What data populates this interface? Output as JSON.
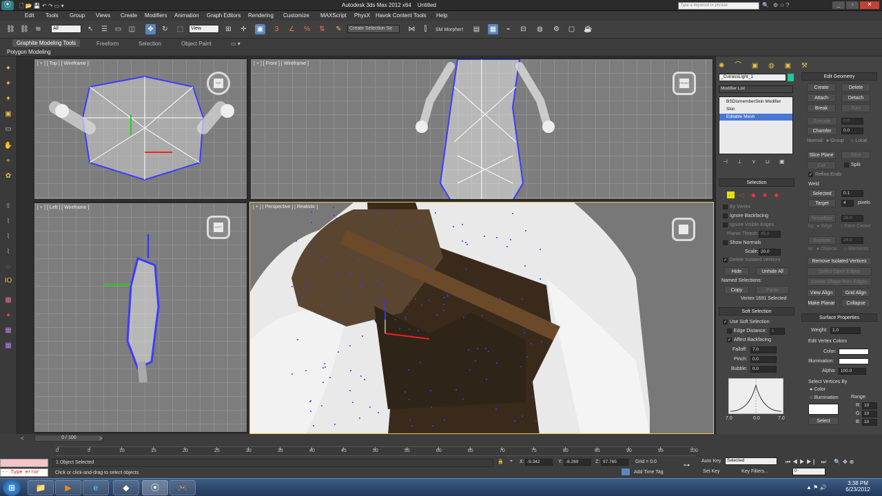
{
  "window": {
    "title": "Autodesk 3ds Max 2012 x64",
    "doc": "Untitled",
    "search_placeholder": "Type a keyword or phrase"
  },
  "menu": [
    "Edit",
    "Tools",
    "Group",
    "Views",
    "Create",
    "Modifiers",
    "Animation",
    "Graph Editors",
    "Rendering",
    "Customize",
    "MAXScript",
    "PhysX",
    "Havok Content Tools",
    "Help"
  ],
  "toolbar": {
    "filter": "All",
    "refcoord": "View",
    "named_selection": "Create Selection Se",
    "morpher": "SM Morpher!"
  },
  "ribbon": {
    "tabs": [
      "Graphite Modeling Tools",
      "Freeform",
      "Selection",
      "Object Paint"
    ],
    "sub": "Polygon Modeling"
  },
  "viewports": {
    "top": "[ + ] [ Top ] [ Wireframe ]",
    "front": "[ + ] [ Front ] [ Wireframe ]",
    "left": "[ + ] [ Left ] [ Wireframe ]",
    "persp": "[ + ] [ Perspective ] [ Realistic ]",
    "cube_top": "TOP",
    "cube_front": "FRONT",
    "cube_left": "LEFT"
  },
  "cmd": {
    "object_name": "_CuirassLight_1",
    "modifier_list": "Modifier List",
    "stack": [
      "BSDismemberSkin Modifier",
      "Skin",
      "Editable Mesh"
    ],
    "selection": {
      "title": "Selection",
      "by_vertex": "By Vertex",
      "ignore_backfacing": "Ignore Backfacing",
      "ignore_visible_edges": "Ignore Visible Edges",
      "planar_thresh": "Planar Thresh:",
      "planar_val": "45.0",
      "show_normals": "Show Normals",
      "scale": "Scale:",
      "scale_val": "20.0",
      "delete_isolated": "Delete Isolated Vertices",
      "hide": "Hide",
      "unhide_all": "Unhide All",
      "named_selections": "Named Selections:",
      "copy": "Copy",
      "paste": "Paste",
      "status": "Vertex 1691 Selected"
    },
    "soft": {
      "title": "Soft Selection",
      "use_soft": "Use Soft Selection",
      "edge_distance": "Edge Distance:",
      "edge_val": "1",
      "affect_backfacing": "Affect Backfacing",
      "falloff": "Falloff:",
      "falloff_val": "7.0",
      "pinch": "Pinch:",
      "pinch_val": "0.0",
      "bubble": "Bubble:",
      "bubble_val": "0.0",
      "curve_labels": [
        "7.0",
        "0.0",
        "7.0"
      ]
    },
    "edit_geom": {
      "title": "Edit Geometry",
      "create": "Create",
      "delete": "Delete",
      "attach": "Attach",
      "detach": "Detach",
      "break": "Break",
      "turn": "Turn",
      "extrude": "Extrude",
      "extrude_val": "0.0",
      "chamfer": "Chamfer",
      "chamfer_val": "0.0",
      "normal": "Normal:",
      "group": "Group",
      "local": "Local",
      "slice_plane": "Slice Plane",
      "slice": "Slice",
      "cut": "Cut",
      "split": "Split",
      "refine_ends": "Refine Ends",
      "weld": "Weld",
      "selected": "Selected",
      "selected_val": "0.1",
      "target": "Target",
      "target_val": "4",
      "pixels": "pixels",
      "tessellate": "Tessellate",
      "tess_val": "25.0",
      "by": "by:",
      "edge": "Edge",
      "face_center": "Face-Center",
      "explode": "Explode",
      "explode_val": "24.0",
      "to": "to:",
      "objects": "Objects",
      "elements": "Elements",
      "remove_isolated": "Remove Isolated Vertices",
      "select_open_edges": "Select Open Edges",
      "create_shape": "Create Shape from Edges",
      "view_align": "View Align",
      "grid_align": "Grid Align",
      "make_planar": "Make Planar",
      "collapse": "Collapse"
    },
    "surface": {
      "title": "Surface Properties",
      "weight": "Weight:",
      "weight_val": "1.0",
      "edit_vertex_colors": "Edit Vertex Colors",
      "color": "Color:",
      "illumination": "Illumination:",
      "alpha": "Alpha:",
      "alpha_val": "100.0",
      "select_by": "Select Vertices By",
      "opt_color": "Color",
      "opt_illum": "Illumination",
      "range": "Range:",
      "r": "R:",
      "g": "G:",
      "b": "B:",
      "r_val": "10",
      "g_val": "10",
      "b_val": "10",
      "select": "Select"
    }
  },
  "timeline": {
    "frame": "0 / 100",
    "ticks": [
      "0",
      "5",
      "10",
      "15",
      "20",
      "25",
      "30",
      "35",
      "40",
      "45",
      "50",
      "55",
      "60",
      "65",
      "70",
      "75",
      "80",
      "85",
      "90",
      "95",
      "100"
    ]
  },
  "status": {
    "script_error": "-- Type error",
    "selected": "1 Object Selected",
    "prompt": "Click or click-and-drag to select objects",
    "x_label": "X:",
    "x": "-9.342",
    "y_label": "Y:",
    "y": "-8.269",
    "z_label": "Z:",
    "z": "97.765",
    "grid": "Grid = 0.0",
    "add_time_tag": "Add Time Tag",
    "auto_key": "Auto Key",
    "set_key": "Set Key",
    "key_mode": "Selected",
    "key_filters": "Key Filters...",
    "frame_val": "0"
  },
  "taskbar": {
    "time": "3:38 PM",
    "date": "6/23/2012"
  }
}
